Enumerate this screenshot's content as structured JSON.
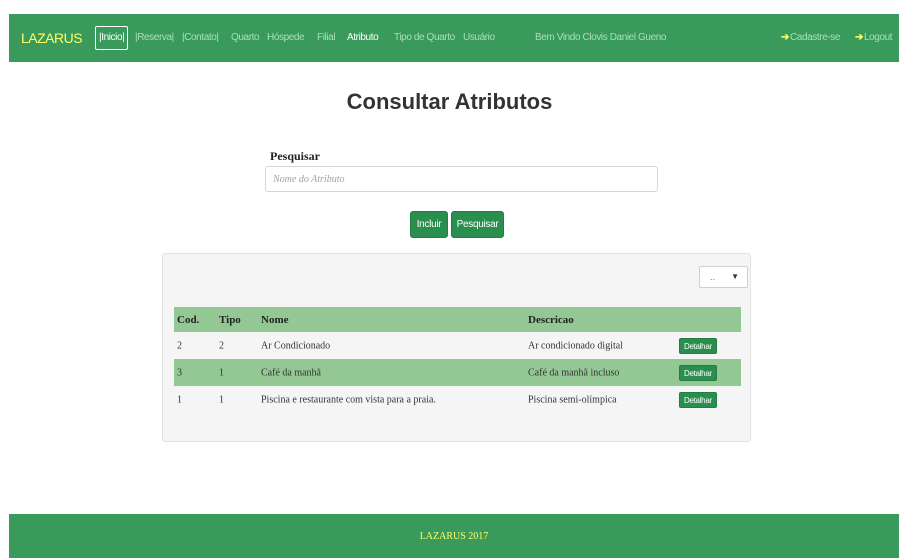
{
  "navbar": {
    "brand": "LAZARUS",
    "items": [
      {
        "label": "|Inicio|"
      },
      {
        "label": "|Reserva|"
      },
      {
        "label": "|Contato|"
      },
      {
        "label": "Quarto"
      },
      {
        "label": "Hóspede"
      },
      {
        "label": "Filial"
      },
      {
        "label": "Atributo"
      },
      {
        "label": "Tipo de Quarto"
      },
      {
        "label": "Usuário"
      }
    ],
    "welcome": "Bem Vindo Clovis Daniel Gueno",
    "signup": "Cadastre-se",
    "logout": "Logout"
  },
  "page": {
    "title": "Consultar Atributos"
  },
  "search": {
    "label": "Pesquisar",
    "placeholder": "Nome do Atributo",
    "value": ""
  },
  "buttons": {
    "incluir": "Incluir",
    "pesquisar": "Pesquisar"
  },
  "panel": {
    "select_value": ".."
  },
  "table": {
    "headers": [
      "Cod.",
      "Tipo",
      "Nome",
      "Descricao"
    ],
    "rows": [
      {
        "cod": "2",
        "tipo": "2",
        "nome": "Ar Condicionado",
        "descricao": "Ar condicionado digital",
        "action": "Detalhar"
      },
      {
        "cod": "3",
        "tipo": "1",
        "nome": "Café da manhã",
        "descricao": "Café da manhã incluso",
        "action": "Detalhar"
      },
      {
        "cod": "1",
        "tipo": "1",
        "nome": "Piscina e restaurante com vista para a praia.",
        "descricao": "Piscina semi-olímpica",
        "action": "Detalhar"
      }
    ]
  },
  "footer": {
    "text": "LAZARUS 2017"
  },
  "colors": {
    "navbar_bg": "#399a5b",
    "brand": "#ffff66",
    "button_bg": "#2a8f4e",
    "table_header_bg": "#93c895",
    "highlight_row_bg": "#93c895"
  }
}
